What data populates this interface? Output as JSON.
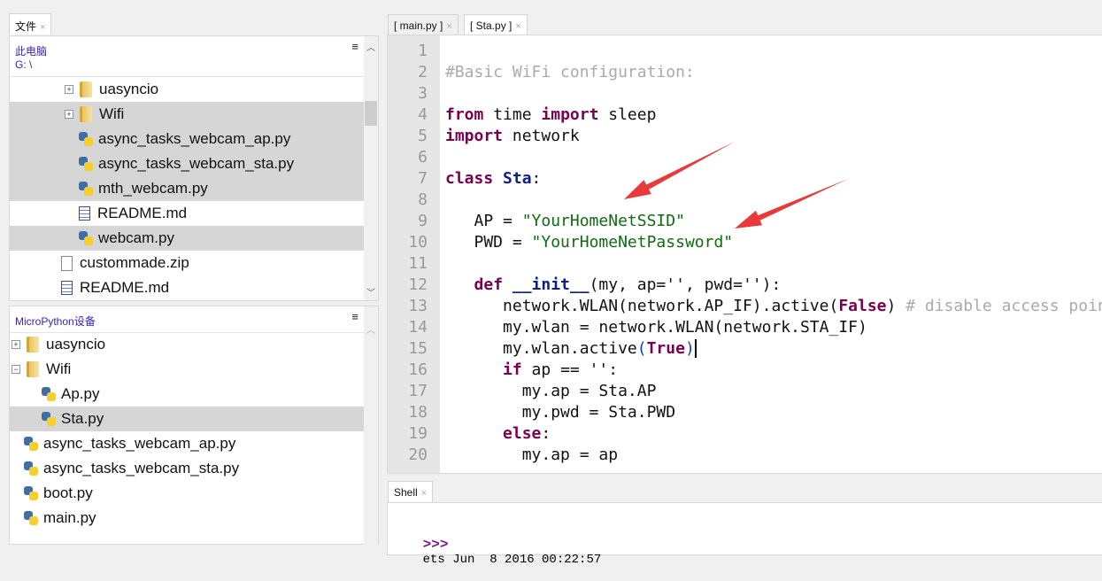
{
  "files_panel": {
    "tab_label": "文件",
    "location_label": "此电脑",
    "path": "G: \\",
    "items": [
      {
        "name": "uasyncio",
        "type": "folder",
        "expander": "+",
        "indent": 1,
        "selected": false
      },
      {
        "name": "Wifi",
        "type": "folder",
        "expander": "+",
        "indent": 1,
        "selected": true
      },
      {
        "name": "async_tasks_webcam_ap.py",
        "type": "python",
        "indent": 2,
        "selected": true
      },
      {
        "name": "async_tasks_webcam_sta.py",
        "type": "python",
        "indent": 2,
        "selected": true
      },
      {
        "name": "mth_webcam.py",
        "type": "python",
        "indent": 2,
        "selected": true
      },
      {
        "name": "README.md",
        "type": "doc",
        "indent": 2,
        "selected": false
      },
      {
        "name": "webcam.py",
        "type": "python",
        "indent": 2,
        "selected": true
      },
      {
        "name": "custommade.zip",
        "type": "file",
        "indent": 1,
        "selected": false
      },
      {
        "name": "README.md",
        "type": "doc",
        "indent": 1,
        "selected": false
      }
    ]
  },
  "device_panel": {
    "title": "MicroPython设备",
    "items": [
      {
        "name": "uasyncio",
        "type": "folder",
        "expander": "+",
        "indent": 0,
        "selected": false
      },
      {
        "name": "Wifi",
        "type": "folder",
        "expander": "−",
        "indent": 0,
        "selected": false
      },
      {
        "name": "Ap.py",
        "type": "python",
        "indent": 1,
        "selected": false
      },
      {
        "name": "Sta.py",
        "type": "python",
        "indent": 1,
        "selected": true
      },
      {
        "name": "async_tasks_webcam_ap.py",
        "type": "python",
        "indent": 0,
        "selected": false
      },
      {
        "name": "async_tasks_webcam_sta.py",
        "type": "python",
        "indent": 0,
        "selected": false
      },
      {
        "name": "boot.py",
        "type": "python",
        "indent": 0,
        "selected": false
      },
      {
        "name": "main.py",
        "type": "python",
        "indent": 0,
        "selected": false
      }
    ]
  },
  "editor": {
    "tabs": [
      {
        "label": "[ main.py ]",
        "active": false
      },
      {
        "label": "[ Sta.py ]",
        "active": true
      }
    ],
    "lines": [
      [],
      [
        [
          "#Basic WiFi configuration:",
          "cm"
        ]
      ],
      [],
      [
        [
          "from",
          "kw"
        ],
        [
          " time ",
          ""
        ],
        [
          "import",
          "kw"
        ],
        [
          " sleep",
          ""
        ]
      ],
      [
        [
          "import",
          "kw"
        ],
        [
          " network",
          ""
        ]
      ],
      [],
      [
        [
          "class",
          "kw"
        ],
        [
          " ",
          ""
        ],
        [
          "Sta",
          "cls"
        ],
        [
          ":",
          ""
        ]
      ],
      [],
      [
        [
          "   AP = ",
          ""
        ],
        [
          "\"YourHomeNetSSID\"",
          "str"
        ]
      ],
      [
        [
          "   PWD = ",
          ""
        ],
        [
          "\"YourHomeNetPassword\"",
          "str"
        ]
      ],
      [],
      [
        [
          "   ",
          ""
        ],
        [
          "def",
          "kw"
        ],
        [
          " ",
          ""
        ],
        [
          "__init__",
          "cls"
        ],
        [
          "(my, ap='', pwd=''):",
          ""
        ]
      ],
      [
        [
          "      network.WLAN(network.AP_IF).active(",
          ""
        ],
        [
          "False",
          "kw"
        ],
        [
          ") ",
          ""
        ],
        [
          "# disable access point",
          "cm"
        ]
      ],
      [
        [
          "      my.wlan = network.WLAN(network.STA_IF)",
          ""
        ]
      ],
      [
        [
          "      my.wlan.active",
          ""
        ],
        [
          "(",
          "bl"
        ],
        [
          "True",
          "kw"
        ],
        [
          ")",
          "bl cur"
        ]
      ],
      [
        [
          "      ",
          ""
        ],
        [
          "if",
          "kw"
        ],
        [
          " ap == '':",
          ""
        ]
      ],
      [
        [
          "        my.ap = Sta.AP",
          ""
        ]
      ],
      [
        [
          "        my.pwd = Sta.PWD",
          ""
        ]
      ],
      [
        [
          "      ",
          ""
        ],
        [
          "else",
          "kw"
        ],
        [
          ":",
          ""
        ]
      ],
      [
        [
          "        my.ap = ap",
          ""
        ]
      ]
    ]
  },
  "shell": {
    "tab_label": "Shell",
    "prompt": ">>>",
    "output": "ets Jun  8 2016 00:22:57"
  },
  "annotations": {
    "arrow_color": "#e83a3a"
  }
}
